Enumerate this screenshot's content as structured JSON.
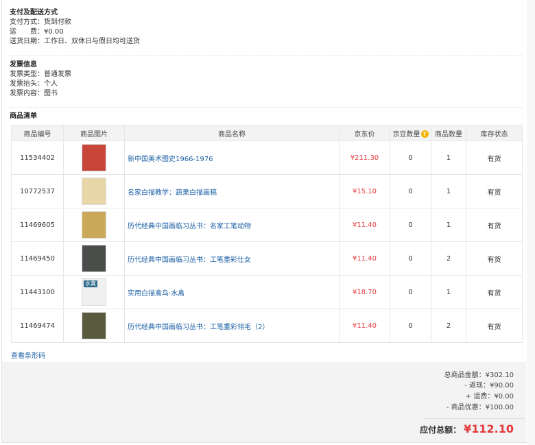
{
  "payment_shipping": {
    "title": "支付及配送方式",
    "lines": [
      {
        "label": "支付方式：",
        "value": "货到付款"
      },
      {
        "label": "运　　费：",
        "value": "¥0.00"
      },
      {
        "label": "送货日期：",
        "value": "工作日、双休日与假日均可送货"
      }
    ]
  },
  "invoice": {
    "title": "发票信息",
    "lines": [
      {
        "label": "发票类型：",
        "value": "普通发票"
      },
      {
        "label": "发票抬头：",
        "value": "个人"
      },
      {
        "label": "发票内容：",
        "value": "图书"
      }
    ]
  },
  "product_list": {
    "title": "商品清单",
    "headers": {
      "id": "商品编号",
      "image": "商品图片",
      "name": "商品名称",
      "price": "京东价",
      "beans": "京豆数量",
      "qty": "商品数量",
      "stock": "库存状态"
    },
    "rows": [
      {
        "id": "11534402",
        "name": "新中国美术图史1966-1976",
        "price": "¥211.30",
        "beans": "0",
        "qty": "1",
        "stock": "有货",
        "thumb_color": "#c8453a"
      },
      {
        "id": "10772537",
        "name": "名家白描教学：蔬果白描画稿",
        "price": "¥15.10",
        "beans": "0",
        "qty": "1",
        "stock": "有货",
        "thumb_color": "#e7d7a8"
      },
      {
        "id": "11469605",
        "name": "历代经典中国画临习丛书：名家工笔动物",
        "price": "¥11.40",
        "beans": "0",
        "qty": "1",
        "stock": "有货",
        "thumb_color": "#caa85a"
      },
      {
        "id": "11469450",
        "name": "历代经典中国画临习丛书：工笔重彩仕女",
        "price": "¥11.40",
        "beans": "0",
        "qty": "2",
        "stock": "有货",
        "thumb_color": "#4b4d4a"
      },
      {
        "id": "11443100",
        "name": "实用白描禽鸟·水禽",
        "price": "¥18.70",
        "beans": "0",
        "qty": "1",
        "stock": "有货",
        "thumb_color": "#f0f0f0",
        "thumb_text": "水禽"
      },
      {
        "id": "11469474",
        "name": "历代经典中国画临习丛书：工笔重彩翎毛（2）",
        "price": "¥11.40",
        "beans": "0",
        "qty": "2",
        "stock": "有货",
        "thumb_color": "#5a5a3e"
      }
    ],
    "barcode_link": "查看条形码"
  },
  "summary": {
    "lines": [
      {
        "label": "总商品金额：",
        "value": "¥302.10"
      },
      {
        "label": "- 返现：",
        "value": "¥90.00"
      },
      {
        "label": "+ 运费：",
        "value": "¥0.00"
      },
      {
        "label": "- 商品优惠：",
        "value": "¥100.00"
      }
    ],
    "total_label": "应付总额：",
    "total_value": "¥112.10"
  },
  "colors": {
    "price_red": "#e4393c",
    "link_blue": "#1a5fa5",
    "help_icon": "#f2b400"
  }
}
